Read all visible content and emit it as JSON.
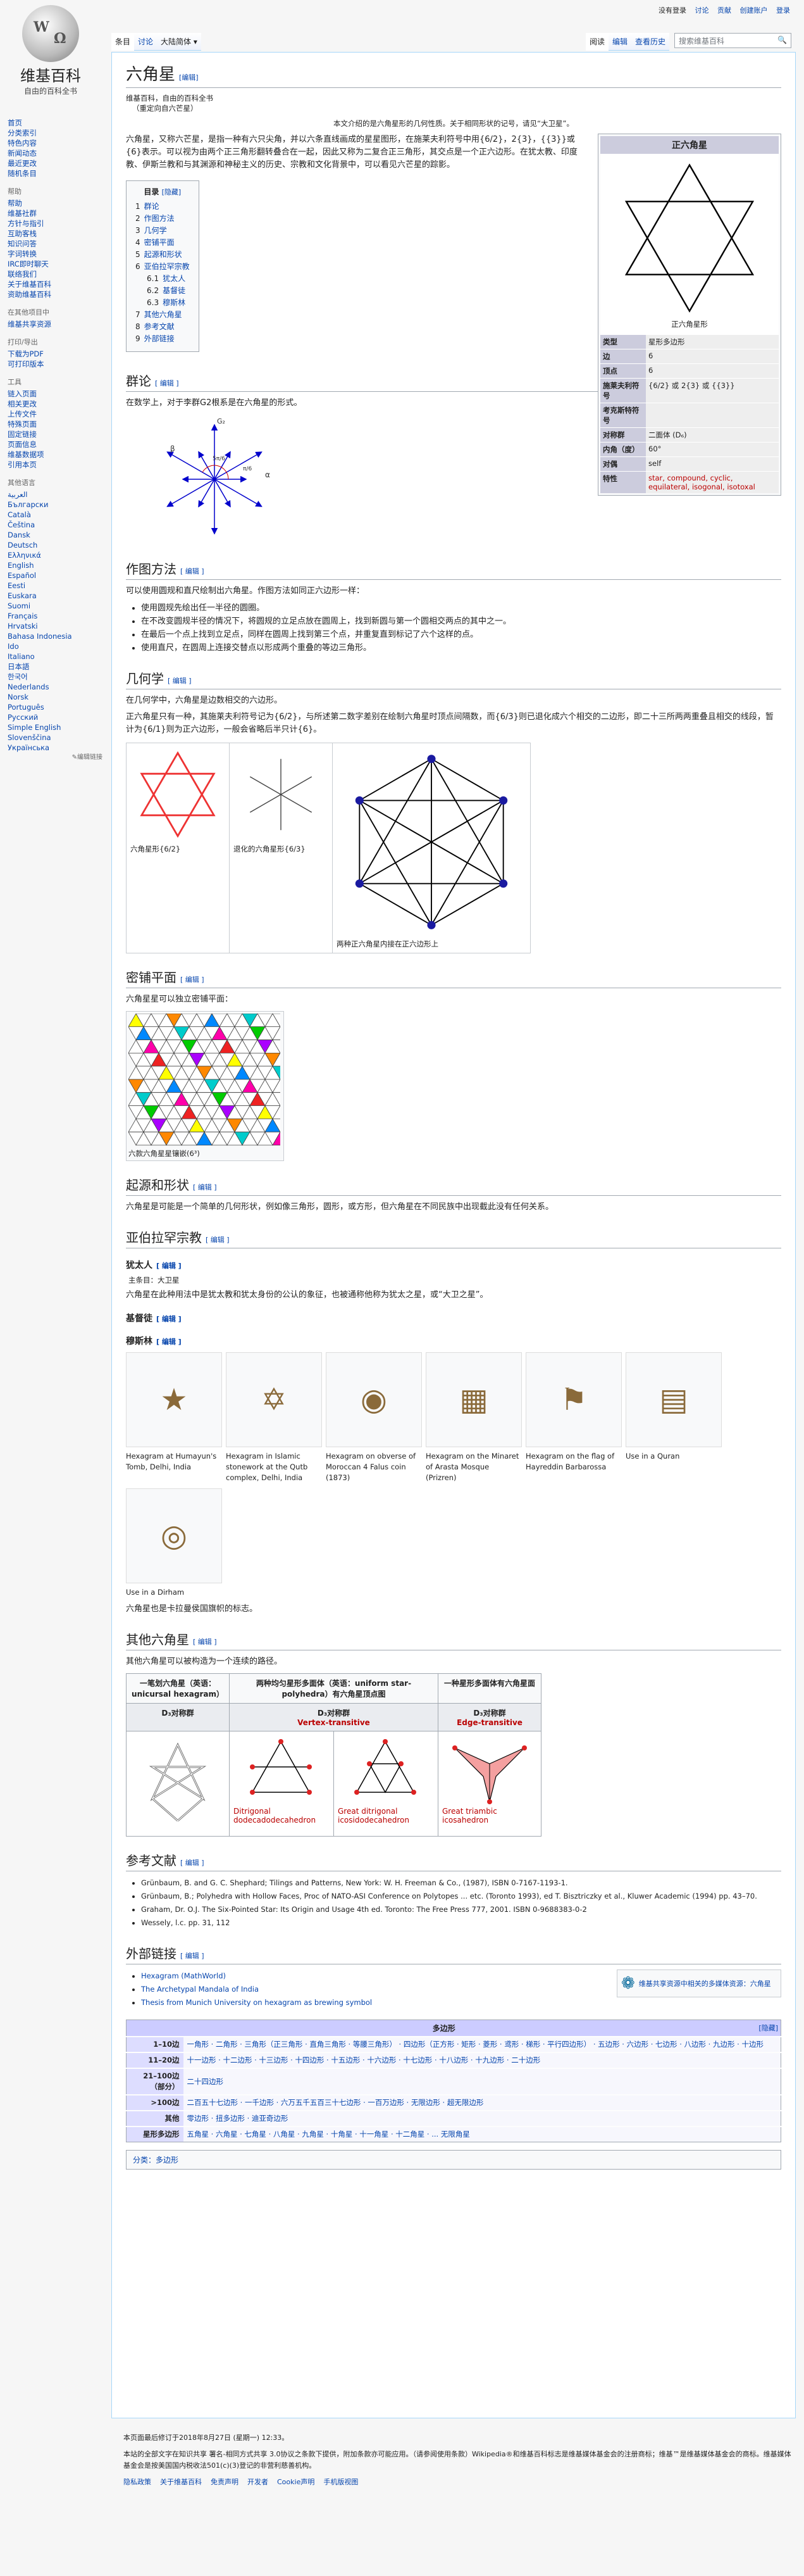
{
  "logo": {
    "title": "维基百科",
    "subtitle": "自由的百科全书"
  },
  "personal": [
    "没有登录",
    "讨论",
    "贡献",
    "创建账户",
    "登录"
  ],
  "tabs": {
    "article": "条目",
    "talk": "讨论",
    "variant": "大陆简体 ▾",
    "read": "阅读",
    "edit": "编辑",
    "history": "查看历史"
  },
  "search": {
    "placeholder": "搜索维基百科"
  },
  "sidebar": [
    {
      "items": [
        "首页",
        "分类索引",
        "特色内容",
        "新闻动态",
        "最近更改",
        "随机条目"
      ]
    },
    {
      "head": "帮助",
      "items": [
        "帮助",
        "维基社群",
        "方针与指引",
        "互助客栈",
        "知识问答",
        "字词转换",
        "IRC即时聊天",
        "联络我们",
        "关于维基百科",
        "资助维基百科"
      ]
    },
    {
      "head": "在其他项目中",
      "items": [
        "维基共享资源"
      ]
    },
    {
      "head": "打印/导出",
      "items": [
        "下载为PDF",
        "可打印版本"
      ]
    },
    {
      "head": "工具",
      "items": [
        "链入页面",
        "相关更改",
        "上传文件",
        "特殊页面",
        "固定链接",
        "页面信息",
        "维基数据项",
        "引用本页"
      ]
    },
    {
      "head": "其他语言",
      "items": [
        "العربية",
        "Български",
        "Català",
        "Čeština",
        "Dansk",
        "Deutsch",
        "Ελληνικά",
        "English",
        "Español",
        "Eesti",
        "Euskara",
        "Suomi",
        "Français",
        "Hrvatski",
        "Bahasa Indonesia",
        "Ido",
        "Italiano",
        "日本語",
        "한국어",
        "Nederlands",
        "Norsk",
        "Português",
        "Русский",
        "Simple English",
        "Slovenščina",
        "Українська"
      ],
      "edit_links": "✎编辑链接"
    }
  ],
  "title": "六角星",
  "edit": "[编辑]",
  "edit_small": "[ 编辑 ]",
  "from": "维基百科，自由的百科全书",
  "redirect": "（重定向自六芒星）",
  "hatnote": "本文介绍的是六角星形的几何性质。关于相同形状的记号，请见“大卫星”。",
  "intro": "六角星，又称六芒星，是指一种有六只尖角，并以六条直线画成的星星图形，在施莱夫利符号中用{6/2}，2{3}，{{3}}或{6}表示。可以视为由两个正三角形翻转叠合在一起，因此又称为二复合正三角形，其交点是一个正六边形。在犹太教、印度教、伊斯兰教和与其渊源和神秘主义的历史、宗教和文化背景中，可以看见六芒星的踪影。",
  "infobox": {
    "title": "正六角星",
    "caption": "正六角星形",
    "rows": [
      [
        "类型",
        "星形多边形"
      ],
      [
        "边",
        "6"
      ],
      [
        "顶点",
        "6"
      ],
      [
        "施莱夫利符号",
        "{6/2} 或 2{3} 或 {{3}}"
      ],
      [
        "考克斯特符号",
        ""
      ],
      [
        "对称群",
        "二面体 (D₆)"
      ],
      [
        "内角（度）",
        "60°"
      ],
      [
        "对偶",
        "self"
      ],
      [
        "特性",
        "star, compound, cyclic, equilateral, isogonal, isotoxal"
      ]
    ]
  },
  "toc": {
    "title": "目录",
    "hide": "[隐藏]",
    "items": [
      [
        "1",
        "群论"
      ],
      [
        "2",
        "作图方法"
      ],
      [
        "3",
        "几何学"
      ],
      [
        "4",
        "密铺平面"
      ],
      [
        "5",
        "起源和形状"
      ],
      [
        "6",
        "亚伯拉罕宗教"
      ],
      [
        "6.1",
        "犹太人"
      ],
      [
        "6.2",
        "基督徒"
      ],
      [
        "6.3",
        "穆斯林"
      ],
      [
        "7",
        "其他六角星"
      ],
      [
        "8",
        "参考文献"
      ],
      [
        "9",
        "外部链接"
      ]
    ]
  },
  "s_group": {
    "title": "群论",
    "text": "在数学上，对于李群G2根系是在六角星的形式。",
    "lbl_g2": "G₂",
    "lbl_b": "β",
    "lbl_a": "α",
    "lbl_5pi": "5π/6",
    "lbl_pi": "π/6"
  },
  "s_construct": {
    "title": "作图方法",
    "text": "可以使用圆规和直尺绘制出六角星。作图方法如同正六边形一样：",
    "steps": [
      "使用圆规先绘出任一半径的圆圈。",
      "在不改变圆规半径的情况下，将圆规的立足点放在圆周上，找到新圆与第一个圆相交两点的其中之一。",
      "在最后一个点上找到立足点，同样在圆周上找到第三个点，并重复直到标记了六个这样的点。",
      "使用直尺，在圆周上连接交替点以形成两个重叠的等边三角形。"
    ]
  },
  "s_geometry": {
    "title": "几何学",
    "text1": "在几何学中，六角星是边数相交的六边形。",
    "text2": "正六角星只有一种，其施莱夫利符号记为{6/2}，与所述第二数字差别在绘制六角星时顶点间隔数，而{6/3}则已退化成六个相交的二边形，即二十三所两两重叠且相交的线段，暂计为{6/1}则为正六边形，一般会省略后半只计{6}。",
    "figs": [
      "六角星形{6/2}",
      "退化的六角星形{6/3}",
      "两种正六角星内接在正六边形上"
    ]
  },
  "s_tiling": {
    "title": "密铺平面",
    "text": "六角星星可以独立密铺平面：",
    "caption": "六款六角星星镶嵌(6³)"
  },
  "s_origin": {
    "title": "起源和形状",
    "text": "六角星是可能是一个简单的几何形状，例如像三角形，圆形，或方形，但六角星在不同民族中出现截此没有任何关系。"
  },
  "s_abr": {
    "title": "亚伯拉罕宗教",
    "jew": {
      "title": "犹太人",
      "main": "主条目：大卫星",
      "text": "六角星在此种用法中是犹太教和犹太身份的公认的象征，也被通称他称为犹太之星，或“大卫之星”。"
    },
    "chr": {
      "title": "基督徒"
    },
    "mus": {
      "title": "穆斯林",
      "gallery": [
        "Hexagram at Humayun's Tomb, Delhi, India",
        "Hexagram in Islamic stonework at the Qutb complex, Delhi, India",
        "Hexagram on obverse of Moroccan 4 Falus coin (1873)",
        "Hexagram on the Minaret of Arasta Mosque (Prizren)",
        "Hexagram on the flag of Hayreddin Barbarossa",
        "Use in a Quran",
        "Use in a Dirham"
      ],
      "after": "六角星也是卡拉曼侯国旗帜的标志。"
    }
  },
  "s_other": {
    "title": "其他六角星",
    "text": "其他六角星可以被构造为一个连续的路径。",
    "th": [
      "一笔划六角星（英语：unicursal hexagram）",
      "两种均匀星形多面体（英语：uniform star-polyhedra）有六角星顶点图",
      "一种星形多面体有六角星面"
    ],
    "sym": [
      "D₃对称群",
      "D₃对称群",
      "D₃对称群"
    ],
    "trans": [
      "Vertex-transitive",
      "Edge-transitive"
    ],
    "names": [
      "Ditrigonal dodecadodecahedron",
      "Great ditrigonal icosidodecahedron",
      "Great triambic icosahedron"
    ]
  },
  "s_refs": {
    "title": "参考文献",
    "items": [
      "Grünbaum, B. and G. C. Shephard; Tilings and Patterns, New York: W. H. Freeman & Co., (1987), ISBN 0-7167-1193-1.",
      "Grünbaum, B.; Polyhedra with Hollow Faces, Proc of NATO-ASI Conference on Polytopes ... etc. (Toronto 1993), ed T. Bisztriczky et al., Kluwer Academic (1994) pp. 43–70.",
      "Graham, Dr. O.J. The Six-Pointed Star: Its Origin and Usage 4th ed. Toronto: The Free Press 777, 2001. ISBN 0-9688383-0-2",
      "Wessely, l.c. pp. 31, 112"
    ]
  },
  "s_ext": {
    "title": "外部链接",
    "items": [
      "Hexagram (MathWorld)",
      "The Archetypal Mandala of India",
      "Thesis from Munich University on hexagram as brewing symbol"
    ],
    "commons": "维基共享资源中相关的多媒体资源：六角星"
  },
  "navbox": {
    "title": "多边形",
    "hide": "[隐藏]",
    "rows": [
      [
        "1–10边",
        "一角形 · 二角形 · 三角形（正三角形 · 直角三角形 · 等腰三角形） · 四边形（正方形 · 矩形 · 菱形 · 鸢形 · 梯形 · 平行四边形） · 五边形 · 六边形 · 七边形 · 八边形 · 九边形 · 十边形"
      ],
      [
        "11–20边",
        "十一边形 · 十二边形 · 十三边形 · 十四边形 · 十五边形 · 十六边形 · 十七边形 · 十八边形 · 十九边形 · 二十边形"
      ],
      [
        "21–100边（部分）",
        "二十四边形"
      ],
      [
        ">100边",
        "二百五十七边形 · 一千边形 · 六万五千五百三十七边形 · 一百万边形 · 无限边形 · 超无限边形"
      ],
      [
        "其他",
        "零边形 · 扭多边形 · 迪亚奇边形"
      ],
      [
        "星形多边形",
        "五角星 · 六角星 · 七角星 · 八角星 · 九角星 · 十角星 · 十一角星 · 十二角星 · ... 无限角星"
      ]
    ]
  },
  "categories": "分类：多边形",
  "footer": {
    "modified": "本页面最后修订于2018年8月27日 (星期一) 12:33。",
    "license": "本站的全部文字在知识共享 署名-相同方式共享 3.0协议之条款下提供，附加条款亦可能应用。（请参阅使用条款）Wikipedia®和维基百科标志是维基媒体基金会的注册商标；维基™是维基媒体基金会的商标。维基媒体基金会是按美国国内税收法501(c)(3)登记的非营利慈善机构。",
    "links": [
      "隐私政策",
      "关于维基百科",
      "免责声明",
      "开发者",
      "Cookie声明",
      "手机版视图"
    ]
  }
}
